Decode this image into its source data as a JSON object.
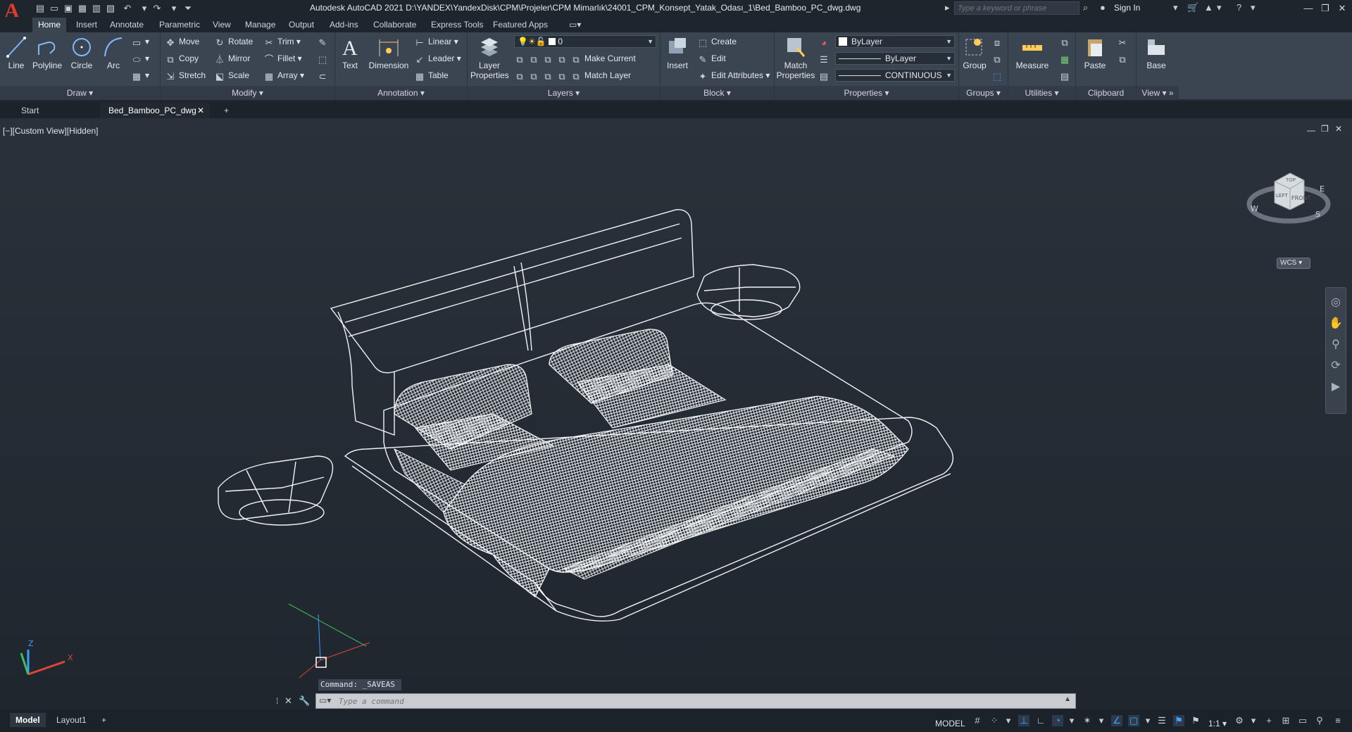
{
  "titlebar": {
    "app_logo": "A",
    "title": "Autodesk AutoCAD 2021   D:\\YANDEX\\YandexDisk\\CPM\\Projeler\\CPM Mimarlık\\24001_CPM_Konsept_Yatak_Odası_1\\Bed_Bamboo_PC_dwg.dwg",
    "search_placeholder": "Type a keyword or phrase",
    "sign_in": "Sign In",
    "quick_access_icons": [
      "new-icon",
      "open-icon",
      "save-icon",
      "save-as-icon",
      "publish-icon",
      "plot-icon",
      "undo-icon",
      "redo-icon"
    ]
  },
  "ribbon_tabs": [
    "Home",
    "Insert",
    "Annotate",
    "Parametric",
    "View",
    "Manage",
    "Output",
    "Add-ins",
    "Collaborate",
    "Express Tools",
    "Featured Apps"
  ],
  "ribbon": {
    "draw": {
      "title": "Draw",
      "line": "Line",
      "polyline": "Polyline",
      "circle": "Circle",
      "arc": "Arc"
    },
    "modify": {
      "title": "Modify",
      "move": "Move",
      "rotate": "Rotate",
      "trim": "Trim",
      "copy": "Copy",
      "mirror": "Mirror",
      "fillet": "Fillet",
      "stretch": "Stretch",
      "scale": "Scale",
      "array": "Array"
    },
    "annotation": {
      "title": "Annotation",
      "text": "Text",
      "dimension": "Dimension",
      "linear": "Linear",
      "leader": "Leader",
      "table": "Table"
    },
    "layers": {
      "title": "Layers",
      "layer_properties": "Layer Properties",
      "current_layer": "0",
      "make_current": "Make Current",
      "match_layer": "Match Layer"
    },
    "block": {
      "title": "Block",
      "insert": "Insert",
      "create": "Create",
      "edit": "Edit",
      "edit_attributes": "Edit Attributes"
    },
    "properties": {
      "title": "Properties",
      "match_properties": "Match Properties",
      "color": "ByLayer",
      "lineweight": "ByLayer",
      "linetype": "CONTINUOUS"
    },
    "groups": {
      "title": "Groups",
      "group": "Group"
    },
    "utilities": {
      "title": "Utilities",
      "measure": "Measure"
    },
    "clipboard": {
      "title": "Clipboard",
      "paste": "Paste"
    },
    "view": {
      "title": "View",
      "base": "Base"
    }
  },
  "file_tabs": {
    "start": "Start",
    "active": "Bed_Bamboo_PC_dwg"
  },
  "viewport": {
    "label": "[−][Custom View][Hidden]",
    "viewcube_top": "TOP",
    "viewcube_front": "FRONT",
    "viewcube_left": "LEFT",
    "compass_w": "W",
    "compass_s": "S",
    "compass_e": "E",
    "wcs": "WCS"
  },
  "command": {
    "history": "Command: _SAVEAS",
    "placeholder": "Type a command"
  },
  "status": {
    "model_tab": "Model",
    "layout_tab": "Layout1",
    "model_label": "MODEL",
    "scale": "1:1"
  },
  "colors": {
    "accent": "#4aa3ff",
    "logo": "#e23a2e",
    "ribbon_bg": "#3b4552",
    "viewport_bg": "#252c35"
  }
}
